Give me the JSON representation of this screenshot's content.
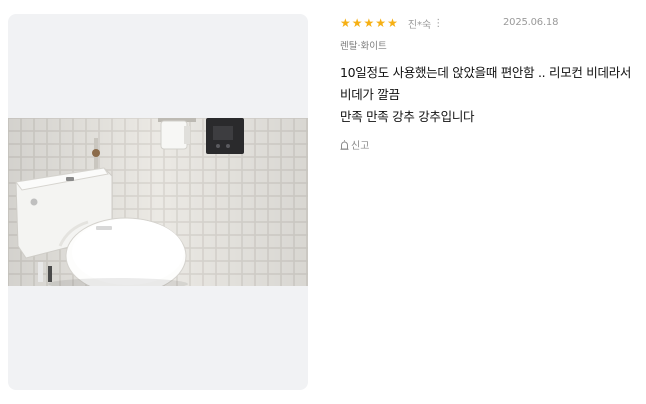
{
  "review": {
    "rating": 5,
    "max_rating": 5,
    "star_color": "#f6b014",
    "reviewer": "진*숙",
    "menu_icon": "kebab-icon",
    "date": "2025.06.18",
    "option": "렌탈·화이트",
    "text_lines": [
      "10일정도 사용했는데 앉았을때 편안함 .. 리모컨 비데라서",
      "비데가 깔끔",
      "만족 만족 강추 강추입니다"
    ],
    "report_label": "신고",
    "report_icon": "siren-icon"
  },
  "photo": {
    "subject": "bidet-toilet-photo"
  }
}
